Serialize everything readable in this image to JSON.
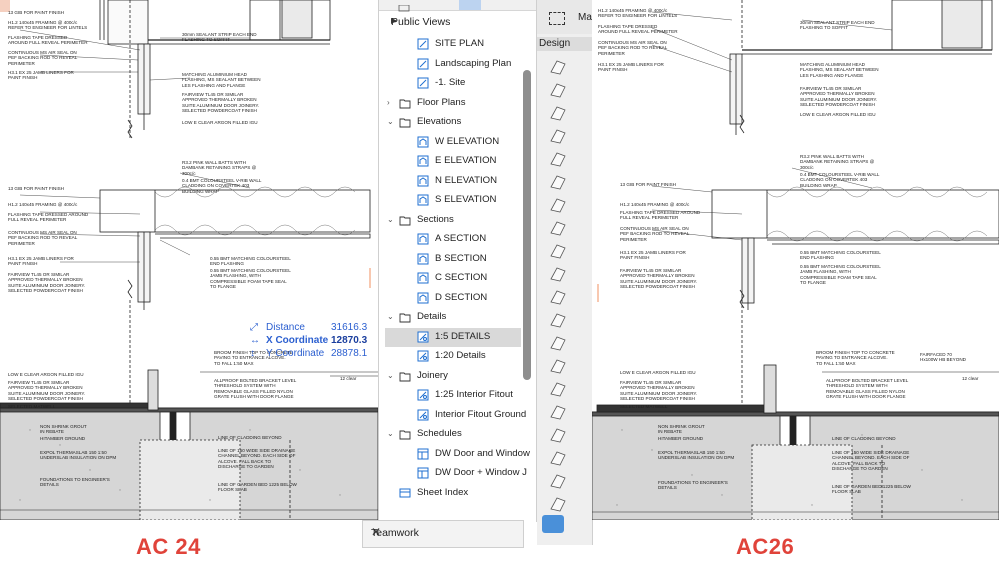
{
  "left_drawing": {
    "caption": "AC 24",
    "notes_top": [
      "13 GIB FOR PAINT FINISH",
      "H1.2 140x45 FRAMING @ 400c/c\nREFER TO ENGINEER FOR LINTELS",
      "FLASHING TAPE DRESSED\nAROUND FULL REVEAL PERIMETER",
      "CONTINUOUS MS AIR SEAL ON\nPEF BACKING ROD TO REVEAL\nPERIMETER",
      "H3.1 EX 25 JAMB LINERS FOR\nPAINT FINISH",
      "30mm SEALANT STRIP EACH END\nFLASHING TO SOFFIT",
      "MATCHING ALUMINIUM HEAD\nFLASHING, MS SEALANT BETWEEN\nLES FLASHING AND FLANGE",
      "FAIRVIEW TL45 OR SIMILAR\nAPPROVED THERMALLY BROKEN\nSUITE ALUMINIUM DOOR JOINERY.\nSELECTED POWDERCOAT FINISH",
      "LOW E CLEAR ARGON FILLED IGU"
    ],
    "notes_mid": [
      "R3.2 PINK WALL BATTS WITH\nDAMBANK RETAINING STRAPS @\n300c/c",
      "0.4 BMT COLOURSTEEL V-RIB WALL\nCLADDING ON COVERTEK 403\nBUILDING WRAP",
      "13 GIB FOR PAINT FINISH",
      "H1.2 140x45 FRAMING @ 400c/c",
      "FLASHING TAPE DRESSED AROUND\nFULL REVEAL PERIMETER",
      "CONTINUOUS MS AIR SEAL ON\nPEF BACKING ROD TO REVEAL\nPERIMETER",
      "H3.1 EX 25 JAMB LINERS FOR\nPAINT FINISH",
      "0.55 BMT MATCHING COLOURSTEEL\nEND FLASHING",
      "0.55 BMT MATCHING COLOURSTEEL\nJAMB FLASHING, WITH\nCOMPRESSIBLE FOAM TAPE SEAL\nTO FLANGE",
      "FAIRVIEW TL45 OR SIMILAR\nAPPROVED THERMALLY BROKEN\nSUITE ALUMINIUM DOOR JOINERY.\nSELECTED POWDERCOAT FINISH"
    ],
    "notes_bottom": [
      "BROOM FINISH TOP TO CONCRETE\nPAVING TO ENTRANCE ALCOVE.\nTO FALL 1:50 MAX",
      "LOW E CLEAR ARGON FILLED IGU",
      "FAIRVIEW TL45 OR SIMILAR\nAPPROVED THERMALLY BROKEN\nSUITE ALUMINIUM DOOR JOINERY.\nSELECTED POWDERCOAT FINISH",
      "SELECTED MATWELL",
      "ALLPROOF BOLTED BRACKET LEVEL\nTHRESHOLD SYSTEM WITH\nREMOVABLE GLASS FILLED NYLON\nGRATE FLUSH WITH DOOR FLANGE",
      "NON SHRINK GROUT\nIN REBATE",
      "HITAMBER GROUND",
      "EXPOL THERMASLAB 150 1:50\nUNDERSLAB INSULATION ON DPM",
      "LINE OF CLADDING BEYOND",
      "LINE OF 150 WIDE SIDE DRAINAGE\nCHANNEL BEYOND. EACH SIDE OF\nALCOVE. FALL BACK TO\nDISCHARGE TO GARDEN",
      "FOUNDATIONS TO ENGINEER'S\nDETAILS",
      "LINE OF GARDEN BED 1225 BELOW\nFLOOR SLAB"
    ],
    "level_mark": "12 clear"
  },
  "coordinates": {
    "distance_label": "Distance",
    "distance_value": "31616.3",
    "x_label": "X Coordinate",
    "x_value": "12870.3",
    "y_label": "Y Coordinate",
    "y_value": "28878.1"
  },
  "navigator": {
    "header": "Public Views",
    "items": [
      {
        "label": "SITE PLAN",
        "icon": "plan-view-icon",
        "level": 1
      },
      {
        "label": "Landscaping Plan",
        "icon": "plan-view-icon",
        "level": 1
      },
      {
        "label": "-1. Site",
        "icon": "plan-view-icon",
        "level": 1
      },
      {
        "label": "Floor Plans",
        "icon": "folder-icon",
        "level": 0,
        "state": "collapsed"
      },
      {
        "label": "Elevations",
        "icon": "folder-icon",
        "level": 0,
        "state": "expanded"
      },
      {
        "label": "W ELEVATION",
        "icon": "elevation-view-icon",
        "level": 1
      },
      {
        "label": "E ELEVATION",
        "icon": "elevation-view-icon",
        "level": 1
      },
      {
        "label": "N ELEVATION",
        "icon": "elevation-view-icon",
        "level": 1
      },
      {
        "label": "S ELEVATION",
        "icon": "elevation-view-icon",
        "level": 1
      },
      {
        "label": "Sections",
        "icon": "folder-icon",
        "level": 0,
        "state": "expanded"
      },
      {
        "label": "A SECTION",
        "icon": "section-view-icon",
        "level": 1
      },
      {
        "label": "B SECTION",
        "icon": "section-view-icon",
        "level": 1
      },
      {
        "label": "C SECTION",
        "icon": "section-view-icon",
        "level": 1
      },
      {
        "label": "D SECTION",
        "icon": "section-view-icon",
        "level": 1
      },
      {
        "label": "Details",
        "icon": "folder-icon",
        "level": 0,
        "state": "expanded"
      },
      {
        "label": "1:5 DETAILS",
        "icon": "detail-view-icon",
        "level": 1,
        "selected": true
      },
      {
        "label": "1:20 Details",
        "icon": "detail-view-icon",
        "level": 1
      },
      {
        "label": "Joinery",
        "icon": "folder-icon",
        "level": 0,
        "state": "expanded"
      },
      {
        "label": "1:25 Interior Fitout",
        "icon": "detail-view-icon",
        "level": 1
      },
      {
        "label": "Interior Fitout Ground",
        "icon": "detail-view-icon",
        "level": 1
      },
      {
        "label": "Schedules",
        "icon": "folder-icon",
        "level": 0,
        "state": "expanded"
      },
      {
        "label": "DW Door and Window",
        "icon": "schedule-view-icon",
        "level": 1
      },
      {
        "label": "DW Door + Window J",
        "icon": "schedule-view-icon",
        "level": 1
      },
      {
        "label": "Sheet Index",
        "icon": "sheet-index-icon",
        "level": 0
      }
    ],
    "teamwork_label": "Teamwork"
  },
  "toolbox": {
    "label": "Design",
    "partial_label": "Ma"
  },
  "right_drawing": {
    "caption": "AC26",
    "notes_top": [
      "H1.2 140x45 FRAMING @ 400c/c\nREFER TO ENGINEER FOR LINTELS",
      "FLASHING TAPE DRESSED\nAROUND FULL REVEAL PERIMETER",
      "CONTINUOUS MS AIR SEAL ON\nPEF BACKING ROD TO REVEAL\nPERIMETER",
      "H3.1 EX 25 JAMB LINERS FOR\nPAINT FINISH",
      "30mm SEALANT STRIP EACH END\nFLASHING TO SOFFIT",
      "MATCHING ALUMINIUM HEAD\nFLASHING, MS SEALANT BETWEEN\nLES FLASHING AND FLANGE",
      "FAIRVIEW TL45 OR SIMILAR\nAPPROVED THERMALLY BROKEN\nSUITE ALUMINIUM DOOR JOINERY.\nSELECTED POWDERCOAT FINISH",
      "LOW E CLEAR ARGON FILLED IGU"
    ],
    "notes_mid": [
      "R3.2 PINK WALL BATTS WITH\nDAMBANK RETAINING STRAPS @\n300c/c",
      "0.4 BMT COLOURSTEEL V-RIB WALL\nCLADDING ON COVERTEK 403\nBUILDING WRAP",
      "13 GIB FOR PAINT FINISH",
      "H1.2 140x45 FRAMING @ 400c/c",
      "FLASHING TAPE DRESSED AROUND\nFULL REVEAL PERIMETER",
      "CONTINUOUS MS AIR SEAL ON\nPEF BACKING ROD TO REVEAL\nPERIMETER",
      "H3.1 EX 25 JAMB LINERS FOR\nPAINT FINISH",
      "0.55 BMT MATCHING COLOURSTEEL\nEND FLASHING",
      "0.55 BMT MATCHING COLOURSTEEL\nJAMB FLASHING, WITH\nCOMPRESSIBLE FOAM TAPE SEAL\nTO FLANGE",
      "FAIRVIEW TL45 OR SIMILAR\nAPPROVED THERMALLY BROKEN\nSUITE ALUMINIUM DOOR JOINERY.\nSELECTED POWDERCOAT FINISH"
    ],
    "notes_bottom": [
      "BROOM FINISH TOP TO CONCRETE\nPAVING TO ENTRANCE ALCOVE.\nTO FALL 1:50 MAX",
      "FAIRFACED 70\nHx100W HB BEYOND",
      "LOW E CLEAR ARGON FILLED IGU",
      "FAIRVIEW TL45 OR SIMILAR\nAPPROVED THERMALLY BROKEN\nSUITE ALUMINIUM DOOR JOINERY.\nSELECTED POWDERCOAT FINISH",
      "SELECTED MATWELL",
      "ALLPROOF BOLTED BRACKET LEVEL\nTHRESHOLD SYSTEM WITH\nREMOVABLE GLASS FILLED NYLON\nGRATE FLUSH WITH DOOR FLANGE",
      "NON SHRINK GROUT\nIN REBATE",
      "HITAMBER GROUND",
      "EXPOL THERMASLAB 150 1:50\nUNDERSLAB INSULATION ON DPM",
      "LINE OF CLADDING BEYOND",
      "LINE OF 150 WIDE SIDE DRAINAGE\nCHANNEL BEYOND. EACH SIDE OF\nALCOVE. FALL BACK TO\nDISCHARGE TO GARDEN",
      "FOUNDATIONS TO ENGINEER'S\nDETAILS",
      "LINE OF GARDEN BED 1225 BELOW\nFLOOR SLAB"
    ],
    "level_mark": "12 clear"
  },
  "colors": {
    "caption": "#e0433a",
    "coord_label": "#2b5fd0",
    "selection": "#d9d9d9",
    "folder": "#ffffff",
    "view_icon": "#1f6fd1"
  }
}
